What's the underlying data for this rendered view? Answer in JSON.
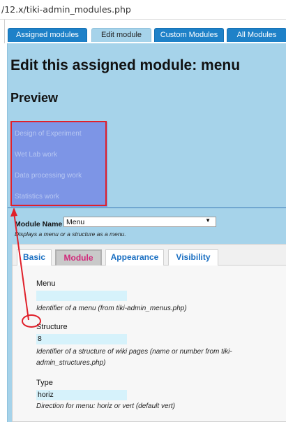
{
  "browser": {
    "url": "/12.x/tiki-admin_modules.php"
  },
  "tabs": [
    {
      "label": "Assigned modules"
    },
    {
      "label": "Edit module"
    },
    {
      "label": "Custom Modules"
    },
    {
      "label": "All Modules"
    }
  ],
  "page": {
    "title": "Edit this assigned module: menu",
    "preview_heading": "Preview"
  },
  "preview_menu": [
    "Design of Experiment",
    "Wet Lab work",
    "Data processing work",
    "Statistics work"
  ],
  "module_name": {
    "label": "Module Name",
    "value": "Menu",
    "description": "Displays a menu or a structure as a menu."
  },
  "inner_tabs": [
    {
      "label": "Basic"
    },
    {
      "label": "Module"
    },
    {
      "label": "Appearance"
    },
    {
      "label": "Visibility"
    }
  ],
  "fields": {
    "menu": {
      "label": "Menu",
      "value": "",
      "help": "Identifier of a menu (from tiki-admin_menus.php)"
    },
    "structure": {
      "label": "Structure",
      "value": "8",
      "help": "Identifier of a structure of wiki pages (name or number from tiki-admin_structures.php)"
    },
    "type": {
      "label": "Type",
      "value": "horiz",
      "help": "Direction for menu: horiz or vert (default vert)"
    }
  },
  "colors": {
    "tab_blue": "#1e81c8",
    "panel_blue": "#a6d3ea",
    "preview_bg": "#7d95e6",
    "annotation_red": "#e0202a",
    "active_inner_tab_text": "#d0287a"
  }
}
